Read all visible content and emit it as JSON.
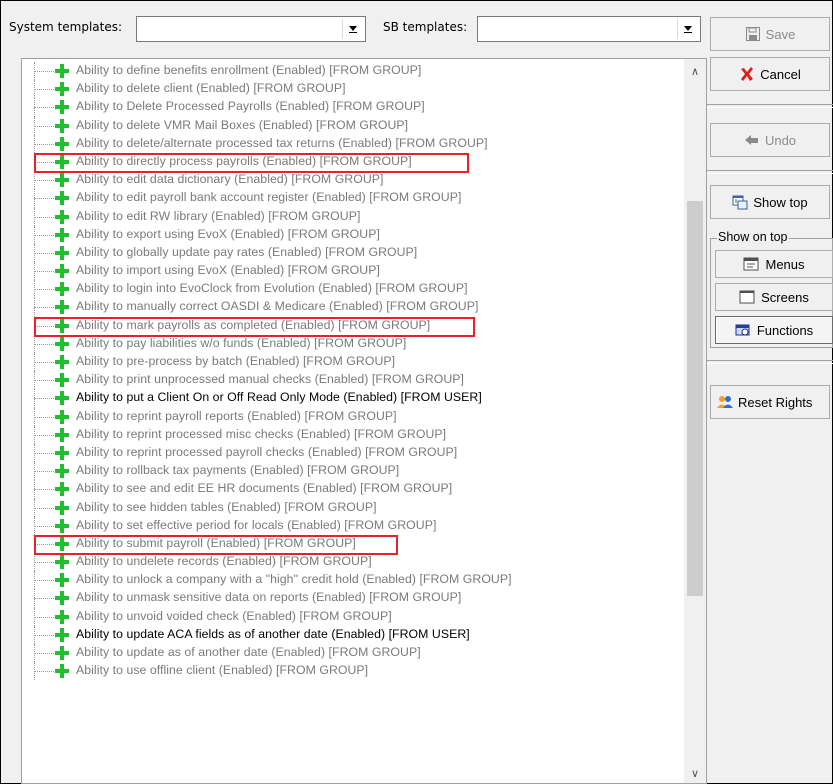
{
  "toolbar": {
    "system_templates_label": "System templates:",
    "system_templates_value": "",
    "sb_templates_label": "SB templates:",
    "sb_templates_value": ""
  },
  "side": {
    "save_label": "Save",
    "cancel_label": "Cancel",
    "undo_label": "Undo",
    "show_top_label": "Show top",
    "show_on_top_title": "Show on top",
    "menus_label": "Menus",
    "screens_label": "Screens",
    "functions_label": "Functions",
    "reset_rights_label": "Reset Rights"
  },
  "tree": {
    "items": [
      {
        "label": "Ability to define benefits enrollment (Enabled) [FROM GROUP]",
        "source": "group"
      },
      {
        "label": "Ability to delete client (Enabled) [FROM GROUP]",
        "source": "group"
      },
      {
        "label": "Ability to Delete Processed Payrolls (Enabled) [FROM GROUP]",
        "source": "group"
      },
      {
        "label": "Ability to delete VMR Mail Boxes (Enabled) [FROM GROUP]",
        "source": "group"
      },
      {
        "label": "Ability to delete/alternate processed tax returns (Enabled) [FROM GROUP]",
        "source": "group"
      },
      {
        "label": "Ability to directly process payrolls (Enabled) [FROM GROUP]",
        "source": "group",
        "highlighted": true
      },
      {
        "label": "Ability to edit data dictionary (Enabled) [FROM GROUP]",
        "source": "group"
      },
      {
        "label": "Ability to edit payroll bank account register (Enabled) [FROM GROUP]",
        "source": "group"
      },
      {
        "label": "Ability to edit RW library (Enabled) [FROM GROUP]",
        "source": "group"
      },
      {
        "label": "Ability to export using EvoX (Enabled) [FROM GROUP]",
        "source": "group"
      },
      {
        "label": "Ability to globally update pay rates (Enabled) [FROM GROUP]",
        "source": "group"
      },
      {
        "label": "Ability to import using EvoX (Enabled) [FROM GROUP]",
        "source": "group"
      },
      {
        "label": "Ability to login into EvoClock from Evolution (Enabled) [FROM GROUP]",
        "source": "group"
      },
      {
        "label": "Ability to manually correct OASDI & Medicare (Enabled) [FROM GROUP]",
        "source": "group"
      },
      {
        "label": "Ability to mark payrolls as completed (Enabled) [FROM GROUP]",
        "source": "group",
        "highlighted": true
      },
      {
        "label": "Ability to pay liabilities w/o funds (Enabled) [FROM GROUP]",
        "source": "group"
      },
      {
        "label": "Ability to pre-process by batch (Enabled) [FROM GROUP]",
        "source": "group"
      },
      {
        "label": "Ability to print unprocessed manual checks (Enabled) [FROM GROUP]",
        "source": "group"
      },
      {
        "label": "Ability to put a Client On or Off Read Only Mode (Enabled) [FROM USER]",
        "source": "user"
      },
      {
        "label": "Ability to reprint payroll reports (Enabled) [FROM GROUP]",
        "source": "group"
      },
      {
        "label": "Ability to reprint processed misc checks (Enabled) [FROM GROUP]",
        "source": "group"
      },
      {
        "label": "Ability to reprint processed payroll checks (Enabled) [FROM GROUP]",
        "source": "group"
      },
      {
        "label": "Ability to rollback tax payments (Enabled) [FROM GROUP]",
        "source": "group"
      },
      {
        "label": "Ability to see and edit EE HR documents (Enabled) [FROM GROUP]",
        "source": "group"
      },
      {
        "label": "Ability to see hidden tables (Enabled) [FROM GROUP]",
        "source": "group"
      },
      {
        "label": "Ability to set effective period for locals (Enabled) [FROM GROUP]",
        "source": "group"
      },
      {
        "label": "Ability to submit payroll (Enabled) [FROM GROUP]",
        "source": "group",
        "highlighted": true
      },
      {
        "label": "Ability to undelete records (Enabled) [FROM GROUP]",
        "source": "group"
      },
      {
        "label": "Ability to unlock a company with a \"high\" credit hold (Enabled) [FROM GROUP]",
        "source": "group"
      },
      {
        "label": "Ability to unmask sensitive data on reports (Enabled) [FROM GROUP]",
        "source": "group"
      },
      {
        "label": "Ability to unvoid voided check (Enabled) [FROM GROUP]",
        "source": "group"
      },
      {
        "label": "Ability to update ACA fields as of another date (Enabled) [FROM USER]",
        "source": "user"
      },
      {
        "label": "Ability to update as of another date (Enabled) [FROM GROUP]",
        "source": "group"
      },
      {
        "label": "Ability to use offline client (Enabled) [FROM GROUP]",
        "source": "group"
      }
    ]
  },
  "colors": {
    "highlight": "#e8202a",
    "plus_icon": "#1fbf2f",
    "group_text": "#7a7a7a",
    "user_text": "#000000"
  }
}
